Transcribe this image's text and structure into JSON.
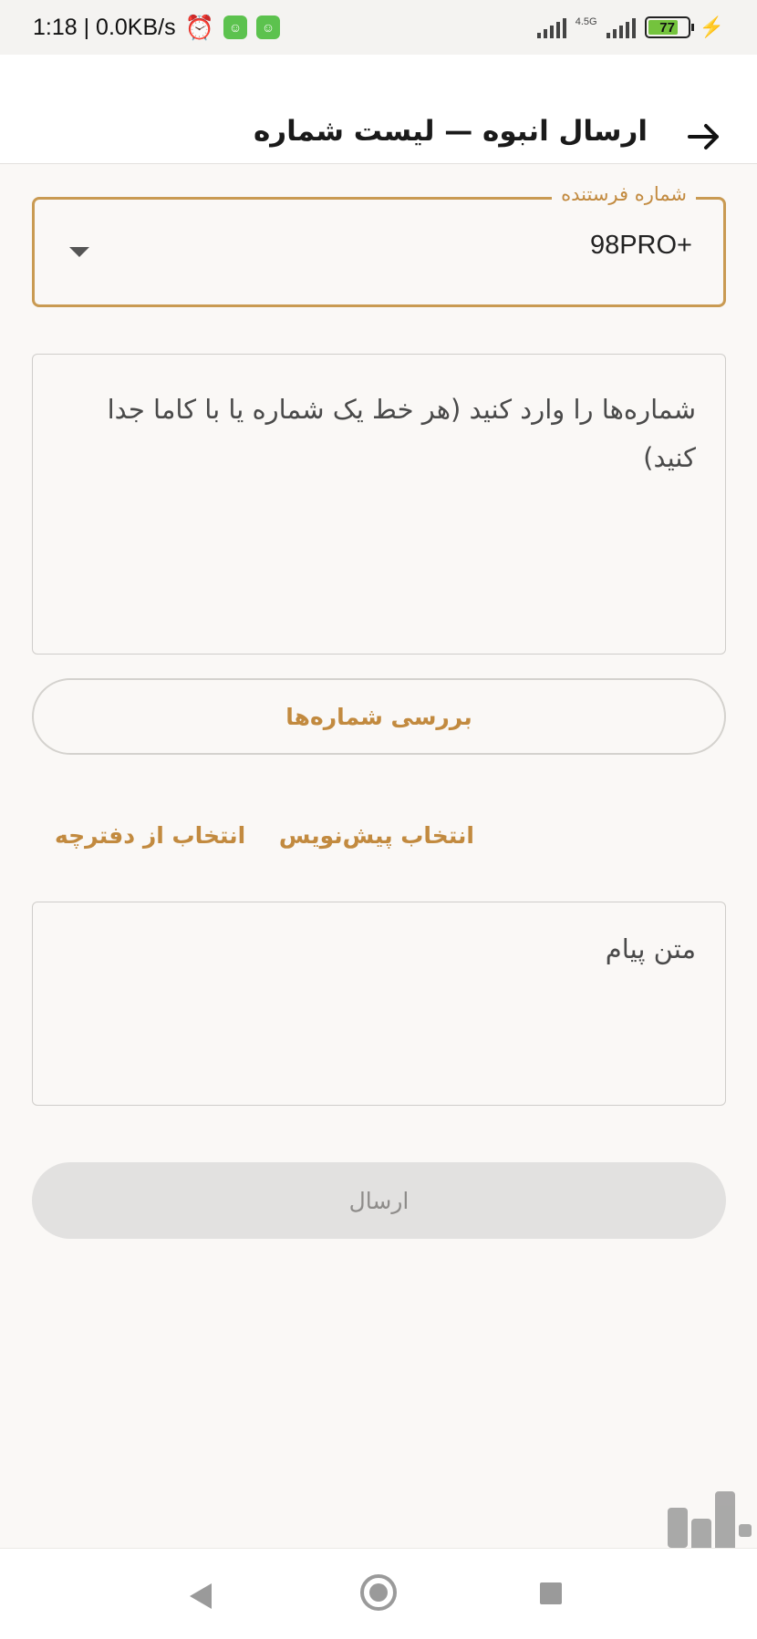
{
  "status_bar": {
    "time_speed": "1:18 | 0.0KB/s",
    "network_type": "4.5G",
    "battery": "77"
  },
  "header": {
    "title": "ارسال انبوه — لیست شماره",
    "back_icon": "arrow-right-icon"
  },
  "sender": {
    "label": "شماره فرستنده",
    "value": "98PRO+"
  },
  "numbers_input": {
    "placeholder": "شماره‌ها را وارد کنید (هر خط یک شماره یا با کاما جدا کنید)"
  },
  "check_button_label": "بررسی شماره‌ها",
  "links": {
    "select_draft": "انتخاب پیش‌نویس",
    "select_contacts": "انتخاب از دفترچه"
  },
  "message_input": {
    "placeholder": "متن پیام"
  },
  "send_button_label": "ارسال",
  "colors": {
    "accent": "#c99a52",
    "accent_text": "#c28a3f",
    "disabled_bg": "#e2e1e0"
  }
}
